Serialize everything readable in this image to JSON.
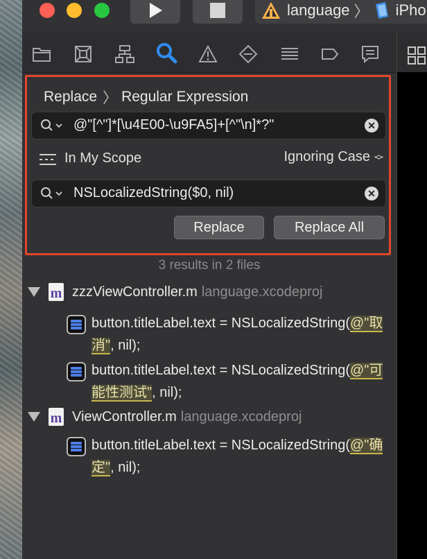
{
  "toolbar": {
    "scheme_project": "language",
    "scheme_device": "iPho"
  },
  "find": {
    "mode": "Replace",
    "submode": "Regular Expression",
    "search_value": "@\"[^\"]*[\\u4E00-\\u9FA5]+[^\"\\n]*?\"",
    "scope": "In My Scope",
    "case_mode": "Ignoring Case",
    "replace_value": "NSLocalizedString($0, nil)",
    "replace_button": "Replace",
    "replace_all_button": "Replace All"
  },
  "results": {
    "summary": "3 results in 2 files",
    "files": [
      {
        "name": "zzzViewController.m",
        "project": "language.xcodeproj",
        "matches": [
          {
            "prefix": "button.titleLabel.text = NSLocalizedString(",
            "match": "@\"取消\"",
            "suffix": ", nil);"
          },
          {
            "prefix": "button.titleLabel.text = NSLocalizedString(",
            "match": "@\"可能性测试\"",
            "suffix": ", nil);"
          }
        ]
      },
      {
        "name": "ViewController.m",
        "project": "language.xcodeproj",
        "matches": [
          {
            "prefix": "button.titleLabel.text = NSLocalizedString(",
            "match": "@\"确定\"",
            "suffix": ", nil);"
          }
        ]
      }
    ]
  },
  "colors": {
    "highlight_border": "#e0462d",
    "close": "#fe5f57",
    "minimize": "#febc2e",
    "zoom": "#28c840",
    "accent": "#2f8cf0"
  }
}
